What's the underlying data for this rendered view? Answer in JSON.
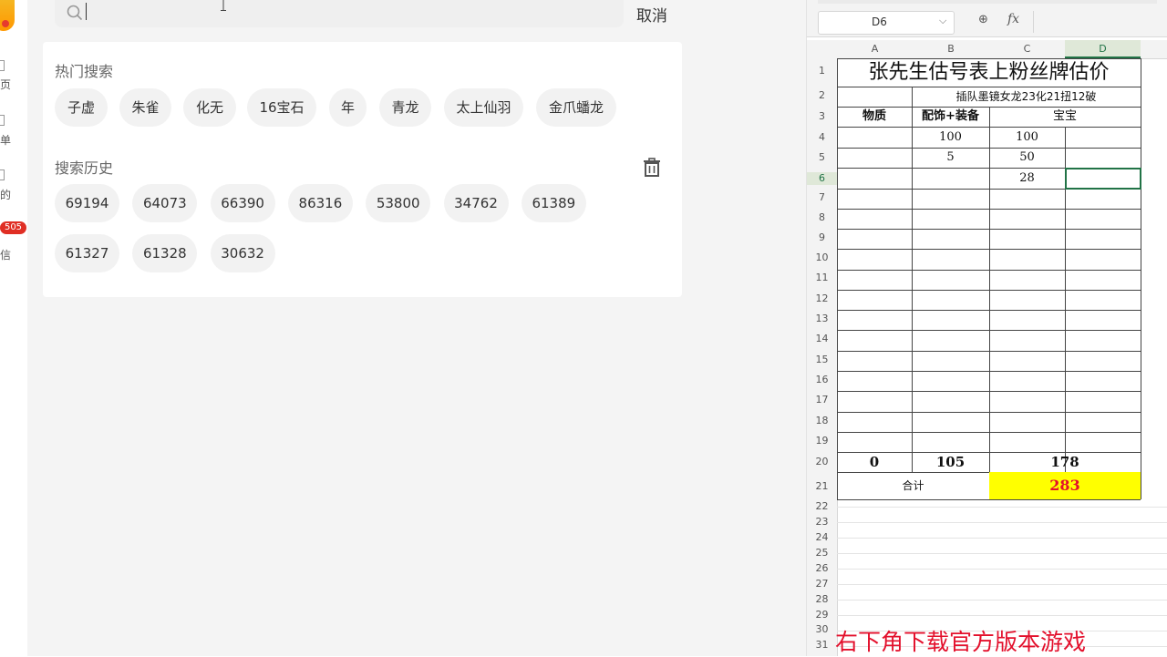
{
  "left_nav": {
    "items": [
      {
        "label": "页"
      },
      {
        "label": "单"
      },
      {
        "label": "的"
      },
      {
        "label": "信"
      }
    ],
    "badge": "505"
  },
  "search": {
    "placeholder": "",
    "cancel_label": "取消"
  },
  "hot_search": {
    "title": "热门搜索",
    "items": [
      "子虚",
      "朱雀",
      "化无",
      "16宝石",
      "年",
      "青龙",
      "太上仙羽",
      "金爪蟠龙"
    ]
  },
  "history": {
    "title": "搜索历史",
    "items": [
      "69194",
      "64073",
      "66390",
      "86316",
      "53800",
      "34762",
      "61389",
      "61327",
      "61328",
      "30632"
    ]
  },
  "sheet": {
    "name_box": "D6",
    "fx_label": "fx",
    "columns": [
      "A",
      "B",
      "C",
      "D"
    ],
    "rows": [
      "1",
      "2",
      "3",
      "4",
      "5",
      "6",
      "7",
      "8",
      "9",
      "10",
      "11",
      "12",
      "13",
      "14",
      "15",
      "16",
      "17",
      "18",
      "19",
      "20",
      "21",
      "22",
      "23",
      "24",
      "25",
      "26",
      "27",
      "28",
      "29",
      "30",
      "31"
    ],
    "title": "张先生估号表上粉丝牌估价",
    "subtitle": "插队墨镜女龙23化21扭12破",
    "headers": {
      "a": "物质",
      "b": "配饰+装备",
      "c": "宝宝"
    },
    "r4": {
      "b": "100",
      "c": "100"
    },
    "r5": {
      "b": "5",
      "c": "50"
    },
    "r6": {
      "c": "28"
    },
    "r20": {
      "a": "0",
      "b": "105",
      "c": "178"
    },
    "r21": {
      "label": "合计",
      "total": "283"
    },
    "highlight_color": "#ffff00",
    "total_color": "#e3102c"
  },
  "watermark": "右下角下载官方版本游戏"
}
